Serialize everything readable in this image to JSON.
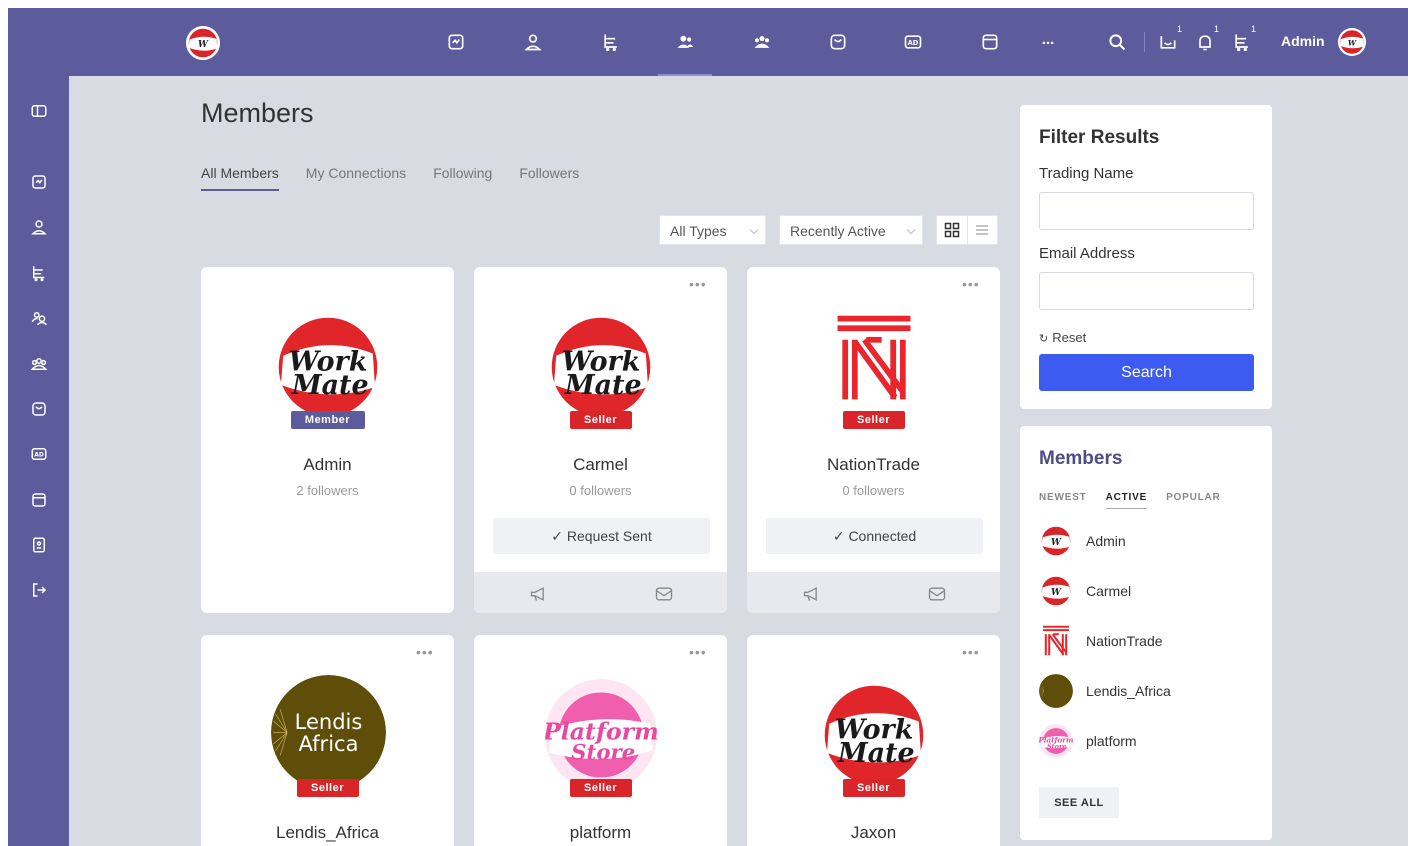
{
  "header": {
    "admin_label": "Admin",
    "notif_counts": [
      "1",
      "1",
      "1"
    ]
  },
  "page": {
    "title": "Members"
  },
  "tabs": [
    {
      "label": "All Members",
      "active": true
    },
    {
      "label": "My Connections",
      "active": false
    },
    {
      "label": "Following",
      "active": false
    },
    {
      "label": "Followers",
      "active": false
    }
  ],
  "filters": {
    "type_value": "All Types",
    "sort_value": "Recently Active"
  },
  "members": [
    {
      "name": "Admin",
      "followers": "2 followers",
      "badge": "Member",
      "action": "",
      "logo": "workmate-logo"
    },
    {
      "name": "Carmel",
      "followers": "0 followers",
      "badge": "Seller",
      "action": "✓ Request Sent",
      "logo": "workmate-logo"
    },
    {
      "name": "NationTrade",
      "followers": "0 followers",
      "badge": "Seller",
      "action": "✓ Connected",
      "logo": "nationtrade-logo"
    },
    {
      "name": "Lendis_Africa",
      "followers": "",
      "badge": "Seller",
      "action": "",
      "logo": "lendis-africa-logo",
      "logo_text": [
        "Lendis",
        "Africa"
      ]
    },
    {
      "name": "platform",
      "followers": "",
      "badge": "Seller",
      "action": "",
      "logo": "platform-store-logo"
    },
    {
      "name": "Jaxon",
      "followers": "",
      "badge": "Seller",
      "action": "",
      "logo": "workmate-logo"
    }
  ],
  "filter_panel": {
    "title": "Filter Results",
    "trading_name_label": "Trading Name",
    "email_label": "Email Address",
    "reset_label": "Reset",
    "search_label": "Search"
  },
  "members_widget": {
    "title": "Members",
    "tabs": [
      {
        "label": "NEWEST",
        "active": false
      },
      {
        "label": "ACTIVE",
        "active": true
      },
      {
        "label": "POPULAR",
        "active": false
      }
    ],
    "list": [
      "Admin",
      "Carmel",
      "NationTrade",
      "Lendis_Africa",
      "platform"
    ],
    "see_all": "SEE ALL"
  },
  "colors": {
    "brand": "#5c5b9b",
    "seller_badge": "#d9252a",
    "search_button": "#3d5af1",
    "background": "#d8dbe2"
  }
}
